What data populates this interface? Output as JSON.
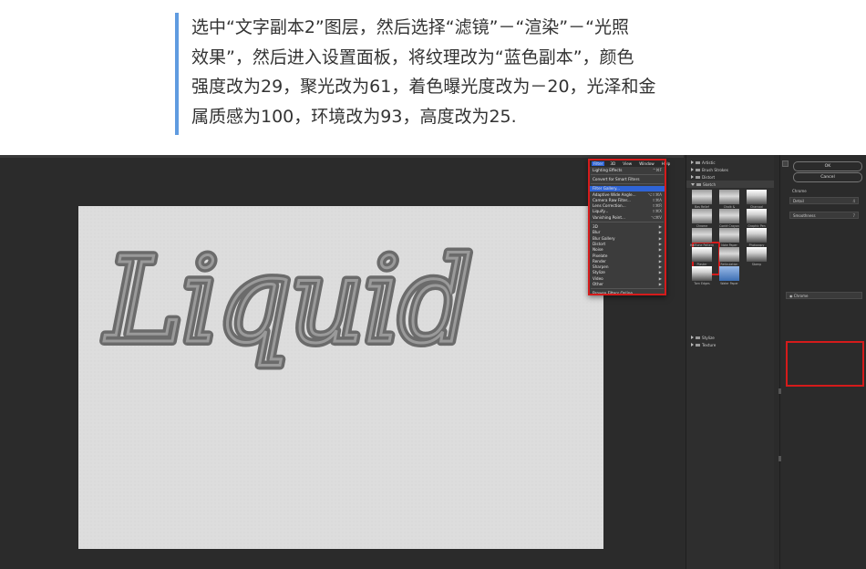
{
  "instruction": {
    "lines": [
      "选中“文字副本2”图层，然后选择“滤镜”－“渲染”－“光照",
      "效果”，然后进入设置面板，将纹理改为“蓝色副本”，颜色",
      "强度改为29，聚光改为61，着色曝光度改为－20，光泽和金",
      "属质感为100，环境改为93，高度改为25."
    ],
    "accent_color": "#5f9be0"
  },
  "canvas": {
    "text": "Liquid",
    "text_color": "#6b6b6b"
  },
  "filter_menu": {
    "menubar": [
      {
        "label": "Filter",
        "active": true
      },
      {
        "label": "3D",
        "active": false
      },
      {
        "label": "View",
        "active": false
      },
      {
        "label": "Window",
        "active": false
      },
      {
        "label": "Help",
        "active": false
      }
    ],
    "items": [
      {
        "label": "Lighting Effects",
        "shortcut": "^⌘F",
        "selected": false
      },
      {
        "separator": true
      },
      {
        "label": "Convert for Smart Filters",
        "shortcut": "",
        "selected": false
      },
      {
        "separator": true
      },
      {
        "label": "Filter Gallery...",
        "shortcut": "",
        "selected": true
      },
      {
        "label": "Adaptive Wide Angle...",
        "shortcut": "⌥⇧⌘A",
        "selected": false
      },
      {
        "label": "Camera Raw Filter...",
        "shortcut": "⇧⌘A",
        "selected": false
      },
      {
        "label": "Lens Correction...",
        "shortcut": "⇧⌘R",
        "selected": false
      },
      {
        "label": "Liquify...",
        "shortcut": "⇧⌘X",
        "selected": false
      },
      {
        "label": "Vanishing Point...",
        "shortcut": "⌥⌘V",
        "selected": false
      },
      {
        "separator": true
      },
      {
        "label": "3D",
        "shortcut": "▶",
        "selected": false
      },
      {
        "label": "Blur",
        "shortcut": "▶",
        "selected": false
      },
      {
        "label": "Blur Gallery",
        "shortcut": "▶",
        "selected": false
      },
      {
        "label": "Distort",
        "shortcut": "▶",
        "selected": false
      },
      {
        "label": "Noise",
        "shortcut": "▶",
        "selected": false
      },
      {
        "label": "Pixelate",
        "shortcut": "▶",
        "selected": false
      },
      {
        "label": "Render",
        "shortcut": "▶",
        "selected": false
      },
      {
        "label": "Sharpen",
        "shortcut": "▶",
        "selected": false
      },
      {
        "label": "Stylize",
        "shortcut": "▶",
        "selected": false
      },
      {
        "label": "Video",
        "shortcut": "▶",
        "selected": false
      },
      {
        "label": "Other",
        "shortcut": "▶",
        "selected": false
      },
      {
        "separator": true
      },
      {
        "label": "Browse Filters Online...",
        "shortcut": "",
        "selected": false
      }
    ]
  },
  "gallery": {
    "folders_top": [
      {
        "label": "Artistic",
        "open": false
      },
      {
        "label": "Brush Strokes",
        "open": false
      },
      {
        "label": "Distort",
        "open": false
      },
      {
        "label": "Sketch",
        "open": true
      }
    ],
    "thumbnails": [
      {
        "label": "Bas Relief",
        "style": "g"
      },
      {
        "label": "Chalk & Charcoal",
        "style": "g"
      },
      {
        "label": "Charcoal",
        "style": "w"
      },
      {
        "label": "Chrome",
        "style": "g"
      },
      {
        "label": "Conté Crayon",
        "style": "g"
      },
      {
        "label": "Graphic Pen",
        "style": "w"
      },
      {
        "label": "Halftone Pattern",
        "style": "g"
      },
      {
        "label": "Note Paper",
        "style": "g"
      },
      {
        "label": "Photocopy",
        "style": "w"
      },
      {
        "label": "Plaster",
        "style": "w"
      },
      {
        "label": "Reticulation",
        "style": "g"
      },
      {
        "label": "Stamp",
        "style": "w"
      },
      {
        "label": "Torn Edges",
        "style": "w"
      },
      {
        "label": "Water Paper",
        "style": "b"
      }
    ],
    "folders_bottom": [
      {
        "label": "Stylize",
        "open": false
      },
      {
        "label": "Texture",
        "open": false
      }
    ]
  },
  "settings": {
    "ok_label": "OK",
    "cancel_label": "Cancel",
    "filter_name": "Chrome",
    "detail_label": "Detail",
    "smoothness_label": "Smoothness",
    "detail_value": "4",
    "smoothness_value": "7",
    "layer_label": "Chrome"
  }
}
